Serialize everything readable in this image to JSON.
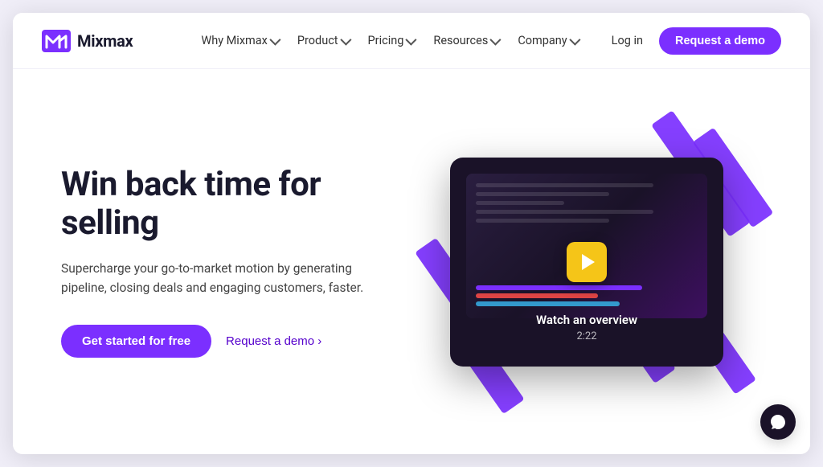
{
  "brand": {
    "name": "Mixmax",
    "logo_alt": "Mixmax logo"
  },
  "nav": {
    "items": [
      {
        "id": "why-mixmax",
        "label": "Why Mixmax",
        "has_dropdown": true
      },
      {
        "id": "product",
        "label": "Product",
        "has_dropdown": true
      },
      {
        "id": "pricing",
        "label": "Pricing",
        "has_dropdown": true
      },
      {
        "id": "resources",
        "label": "Resources",
        "has_dropdown": true
      },
      {
        "id": "company",
        "label": "Company",
        "has_dropdown": true
      }
    ],
    "login_label": "Log in",
    "cta_label": "Request a demo"
  },
  "hero": {
    "title": "Win back time for selling",
    "subtitle": "Supercharge your go-to-market motion by generating pipeline, closing deals and engaging customers, faster.",
    "btn_primary": "Get started for free",
    "btn_secondary": "Request a demo ›"
  },
  "video": {
    "label": "Watch an overview",
    "duration": "2:22"
  },
  "chat": {
    "label": "Chat support"
  }
}
